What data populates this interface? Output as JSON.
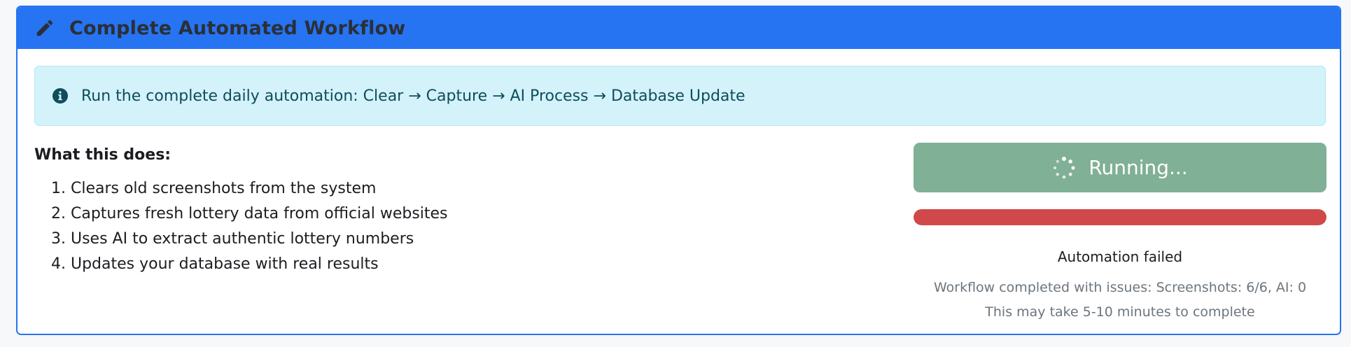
{
  "card": {
    "title": "Complete Automated Workflow",
    "header_icon": "pencil-icon",
    "header_color": "#2674f2"
  },
  "alert": {
    "icon": "info-circle-icon",
    "text": "Run the complete daily automation: Clear → Capture → AI Process → Database Update"
  },
  "description": {
    "heading": "What this does:",
    "steps": [
      "1. Clears old screenshots from the system",
      "2. Captures fresh lottery data from official websites",
      "3. Uses AI to extract authentic lottery numbers",
      "4. Updates your database with real results"
    ]
  },
  "run_button": {
    "label": "Running...",
    "icon": "spinner-icon",
    "color": "#80b095"
  },
  "progress": {
    "value_percent": 100,
    "color": "#d1484a"
  },
  "status": {
    "message": "Automation failed",
    "detail": "Workflow completed with issues: Screenshots: 6/6, AI: 0",
    "note": "This may take 5-10 minutes to complete"
  }
}
